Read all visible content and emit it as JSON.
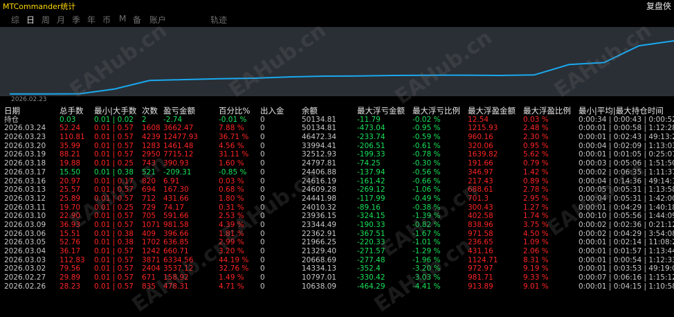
{
  "app": {
    "title": "MTCommander统计",
    "replay_label": "复盘俠"
  },
  "tabs": [
    {
      "label": "综",
      "active": false
    },
    {
      "label": "日",
      "active": true
    },
    {
      "label": "周",
      "active": false
    },
    {
      "label": "月",
      "active": false
    },
    {
      "label": "季",
      "active": false
    },
    {
      "label": "年",
      "active": false
    },
    {
      "label": "币",
      "active": false
    },
    {
      "label": "M",
      "active": false
    },
    {
      "label": "备",
      "active": false
    },
    {
      "label": "账户",
      "active": false
    },
    {
      "label": "轨迹",
      "active": false
    }
  ],
  "chart": {
    "start_date_label": "2026.02.23",
    "line_color": "#19a9f0",
    "bg_color": "#2a2f35"
  },
  "watermark": "EAHub.cn",
  "colors": {
    "positive": "#ff2424",
    "negative": "#18e35a",
    "title": "#ffd800"
  },
  "table": {
    "headers": [
      "日期",
      "总手数",
      "最小|大手数",
      "次数",
      "盈亏金额",
      "百分比%",
      "出入金",
      "余额",
      "最大浮亏金额",
      "最大浮亏比例",
      "最大浮盈金额",
      "最大浮盈比例",
      "最小|平均|最大持仓时间"
    ],
    "holding": {
      "label": "持仓",
      "lots": "0.03",
      "minmax": "0.01 | 0.02",
      "count": "2",
      "pnl": "-2.74",
      "pct": "-0.01 %",
      "deposit": "0",
      "balance": "50134.81",
      "maxloss": "-11.79",
      "maxloss_pct": "-0.02 %",
      "maxprofit": "12.54",
      "maxprofit_pct": "0.03 %",
      "time": "0:00:34 | 0:00:43 | 0:00:52"
    },
    "rows": [
      {
        "date": "2026.03.24",
        "lots": "52.24",
        "minmax": "0.01 | 0.57",
        "count": "1608",
        "pnl": "3662.47",
        "pct": "7.88 %",
        "deposit": "0",
        "balance": "50134.81",
        "maxloss": "-473.04",
        "maxloss_pct": "-0.95 %",
        "maxprofit": "1215.93",
        "maxprofit_pct": "2.48 %",
        "time": "0:00:01 | 0:00:58 | 1:12:28"
      },
      {
        "date": "2026.03.23",
        "lots": "110.81",
        "minmax": "0.01 | 0.57",
        "count": "4239",
        "pnl": "12477.93",
        "pct": "36.71 %",
        "deposit": "0",
        "balance": "46472.34",
        "maxloss": "-233.74",
        "maxloss_pct": "-0.59 %",
        "maxprofit": "960.16",
        "maxprofit_pct": "2.30 %",
        "time": "0:00:01 | 0:02:43 | 49:13:25"
      },
      {
        "date": "2026.03.20",
        "lots": "35.99",
        "minmax": "0.01 | 0.57",
        "count": "1283",
        "pnl": "1461.48",
        "pct": "4.56 %",
        "deposit": "0",
        "balance": "33994.41",
        "maxloss": "-206.51",
        "maxloss_pct": "-0.61 %",
        "maxprofit": "320.06",
        "maxprofit_pct": "0.95 %",
        "time": "0:00:04 | 0:02:09 | 1:13:03"
      },
      {
        "date": "2026.03.19",
        "lots": "88.21",
        "minmax": "0.01 | 0.57",
        "count": "2950",
        "pnl": "7715.12",
        "pct": "31.11 %",
        "deposit": "0",
        "balance": "32512.93",
        "maxloss": "-199.33",
        "maxloss_pct": "-0.78 %",
        "maxprofit": "1639.82",
        "maxprofit_pct": "5.62 %",
        "time": "0:00:01 | 0:01:05 | 0:25:07"
      },
      {
        "date": "2026.03.18",
        "lots": "19.88",
        "minmax": "0.01 | 0.25",
        "count": "743",
        "pnl": "390.93",
        "pct": "1.60 %",
        "deposit": "0",
        "balance": "24797.81",
        "maxloss": "-74.25",
        "maxloss_pct": "-0.30 %",
        "maxprofit": "191.66",
        "maxprofit_pct": "0.79 %",
        "time": "0:00:03 | 0:05:06 | 1:51:50"
      },
      {
        "date": "2026.03.17",
        "lots": "15.50",
        "minmax": "0.01 | 0.38",
        "count": "521",
        "pnl": "-209.31",
        "pct": "-0.85 %",
        "deposit": "0",
        "balance": "24406.88",
        "maxloss": "-137.94",
        "maxloss_pct": "-0.56 %",
        "maxprofit": "346.97",
        "maxprofit_pct": "1.42 %",
        "time": "0:00:02 | 0:06:35 | 1:11:37"
      },
      {
        "date": "2026.03.16",
        "lots": "20.97",
        "minmax": "0.01 | 0.17",
        "count": "820",
        "pnl": "6.91",
        "pct": "0.03 %",
        "deposit": "0",
        "balance": "24616.19",
        "maxloss": "-161.42",
        "maxloss_pct": "-0.66 %",
        "maxprofit": "217.43",
        "maxprofit_pct": "0.89 %",
        "time": "0:00:04 | 0:14:36 | 49:14:15"
      },
      {
        "date": "2026.03.13",
        "lots": "25.57",
        "minmax": "0.01 | 0.57",
        "count": "694",
        "pnl": "167.30",
        "pct": "0.68 %",
        "deposit": "0",
        "balance": "24609.28",
        "maxloss": "-269.12",
        "maxloss_pct": "-1.06 %",
        "maxprofit": "688.61",
        "maxprofit_pct": "2.78 %",
        "time": "0:00:05 | 0:05:31 | 1:13:58"
      },
      {
        "date": "2026.03.12",
        "lots": "25.89",
        "minmax": "0.01 | 0.57",
        "count": "712",
        "pnl": "431.66",
        "pct": "1.80 %",
        "deposit": "0",
        "balance": "24441.98",
        "maxloss": "-117.99",
        "maxloss_pct": "-0.49 %",
        "maxprofit": "701.3",
        "maxprofit_pct": "2.95 %",
        "time": "0:00:04 | 0:05:31 | 1:42:00"
      },
      {
        "date": "2026.03.11",
        "lots": "19.70",
        "minmax": "0.01 | 0.25",
        "count": "729",
        "pnl": "74.17",
        "pct": "0.31 %",
        "deposit": "0",
        "balance": "24010.32",
        "maxloss": "-89.16",
        "maxloss_pct": "-0.38 %",
        "maxprofit": "300.43",
        "maxprofit_pct": "1.27 %",
        "time": "0:00:01 | 0:04:29 | 1:40:18"
      },
      {
        "date": "2026.03.10",
        "lots": "22.90",
        "minmax": "0.01 | 0.57",
        "count": "705",
        "pnl": "591.66",
        "pct": "2.53 %",
        "deposit": "0",
        "balance": "23936.15",
        "maxloss": "-324.15",
        "maxloss_pct": "-1.39 %",
        "maxprofit": "402.58",
        "maxprofit_pct": "1.74 %",
        "time": "0:00:10 | 0:05:56 | 1:44:09"
      },
      {
        "date": "2026.03.09",
        "lots": "36.93",
        "minmax": "0.01 | 0.57",
        "count": "1071",
        "pnl": "981.58",
        "pct": "4.39 %",
        "deposit": "0",
        "balance": "23344.49",
        "maxloss": "-190.33",
        "maxloss_pct": "-0.82 %",
        "maxprofit": "838.96",
        "maxprofit_pct": "3.75 %",
        "time": "0:00:02 | 0:02:36 | 0:21:12"
      },
      {
        "date": "2026.03.06",
        "lots": "15.51",
        "minmax": "0.01 | 0.38",
        "count": "409",
        "pnl": "396.66",
        "pct": "1.81 %",
        "deposit": "0",
        "balance": "22362.91",
        "maxloss": "-367.51",
        "maxloss_pct": "-1.67 %",
        "maxprofit": "971.58",
        "maxprofit_pct": "4.50 %",
        "time": "0:00:02 | 0:04:29 | 3:54:08"
      },
      {
        "date": "2026.03.05",
        "lots": "52.76",
        "minmax": "0.01 | 0.38",
        "count": "1702",
        "pnl": "636.85",
        "pct": "2.99 %",
        "deposit": "0",
        "balance": "21966.25",
        "maxloss": "-220.33",
        "maxloss_pct": "-1.01 %",
        "maxprofit": "236.65",
        "maxprofit_pct": "1.09 %",
        "time": "0:00:01 | 0:02:14 | 11:08:20"
      },
      {
        "date": "2026.03.04",
        "lots": "36.17",
        "minmax": "0.01 | 0.57",
        "count": "1242",
        "pnl": "660.71",
        "pct": "3.20 %",
        "deposit": "0",
        "balance": "21329.40",
        "maxloss": "-271.57",
        "maxloss_pct": "-1.29 %",
        "maxprofit": "431.16",
        "maxprofit_pct": "2.06 %",
        "time": "0:00:01 | 0:01:57 | 1:13:44"
      },
      {
        "date": "2026.03.03",
        "lots": "112.83",
        "minmax": "0.01 | 0.57",
        "count": "3871",
        "pnl": "6334.56",
        "pct": "44.19 %",
        "deposit": "0",
        "balance": "20668.69",
        "maxloss": "-277.48",
        "maxloss_pct": "-1.96 %",
        "maxprofit": "1124.71",
        "maxprofit_pct": "8.31 %",
        "time": "0:00:01 | 0:00:54 | 1:12:33"
      },
      {
        "date": "2026.03.02",
        "lots": "79.56",
        "minmax": "0.01 | 0.57",
        "count": "2404",
        "pnl": "3537.12",
        "pct": "32.76 %",
        "deposit": "0",
        "balance": "14334.13",
        "maxloss": "-352.4",
        "maxloss_pct": "-3.20 %",
        "maxprofit": "972.97",
        "maxprofit_pct": "9.19 %",
        "time": "0:00:01 | 0:03:53 | 49:19:07"
      },
      {
        "date": "2026.02.27",
        "lots": "29.89",
        "minmax": "0.01 | 0.57",
        "count": "671",
        "pnl": "158.92",
        "pct": "1.49 %",
        "deposit": "0",
        "balance": "10797.01",
        "maxloss": "-330.42",
        "maxloss_pct": "-3.03 %",
        "maxprofit": "981.71",
        "maxprofit_pct": "9.33 %",
        "time": "0:00:07 | 0:06:16 | 1:15:12"
      },
      {
        "date": "2026.02.26",
        "lots": "28.23",
        "minmax": "0.01 | 0.57",
        "count": "835",
        "pnl": "478.31",
        "pct": "4.71 %",
        "deposit": "0",
        "balance": "10638.09",
        "maxloss": "-464.29",
        "maxloss_pct": "-4.41 %",
        "maxprofit": "913.89",
        "maxprofit_pct": "9.01 %",
        "time": "0:00:01 | 0:04:15 | 1:10:58"
      }
    ]
  }
}
